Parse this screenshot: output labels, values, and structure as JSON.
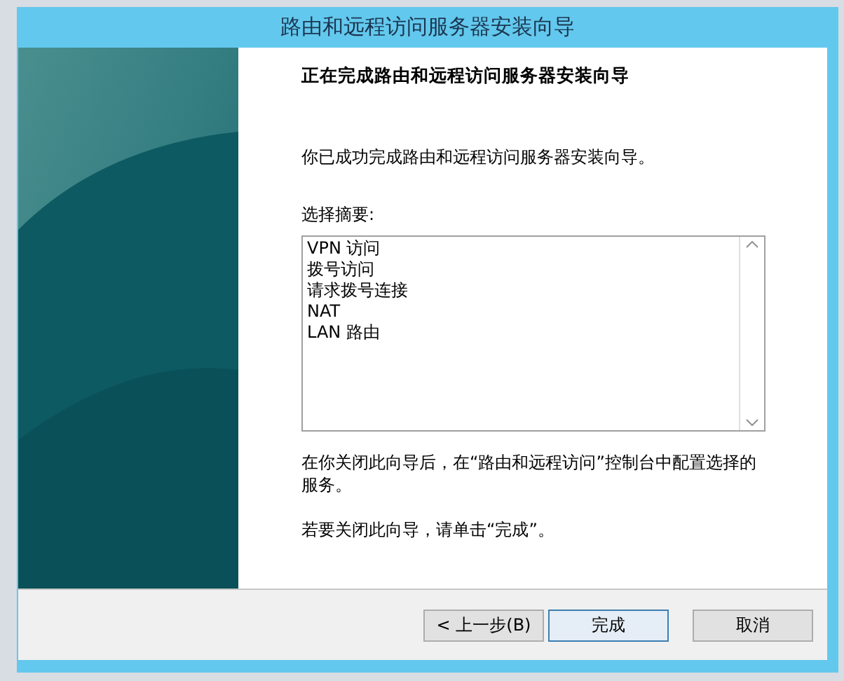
{
  "window": {
    "title": "路由和远程访问服务器安装向导"
  },
  "heading": "正在完成路由和远程访问服务器安装向导",
  "intro": "你已成功完成路由和远程访问服务器安装向导。",
  "summary": {
    "label": "选择摘要:",
    "items": [
      "VPN 访问",
      "拨号访问",
      "请求拨号连接",
      "NAT",
      "LAN 路由"
    ]
  },
  "note": "在你关闭此向导后，在“路由和远程访问”控制台中配置选择的服务。",
  "closing": "若要关闭此向导，请单击“完成”。",
  "buttons": [
    {
      "label": "< 上一步(B)",
      "default": false
    },
    {
      "label": "完成",
      "default": true
    },
    {
      "label": "取消",
      "default": false
    }
  ]
}
